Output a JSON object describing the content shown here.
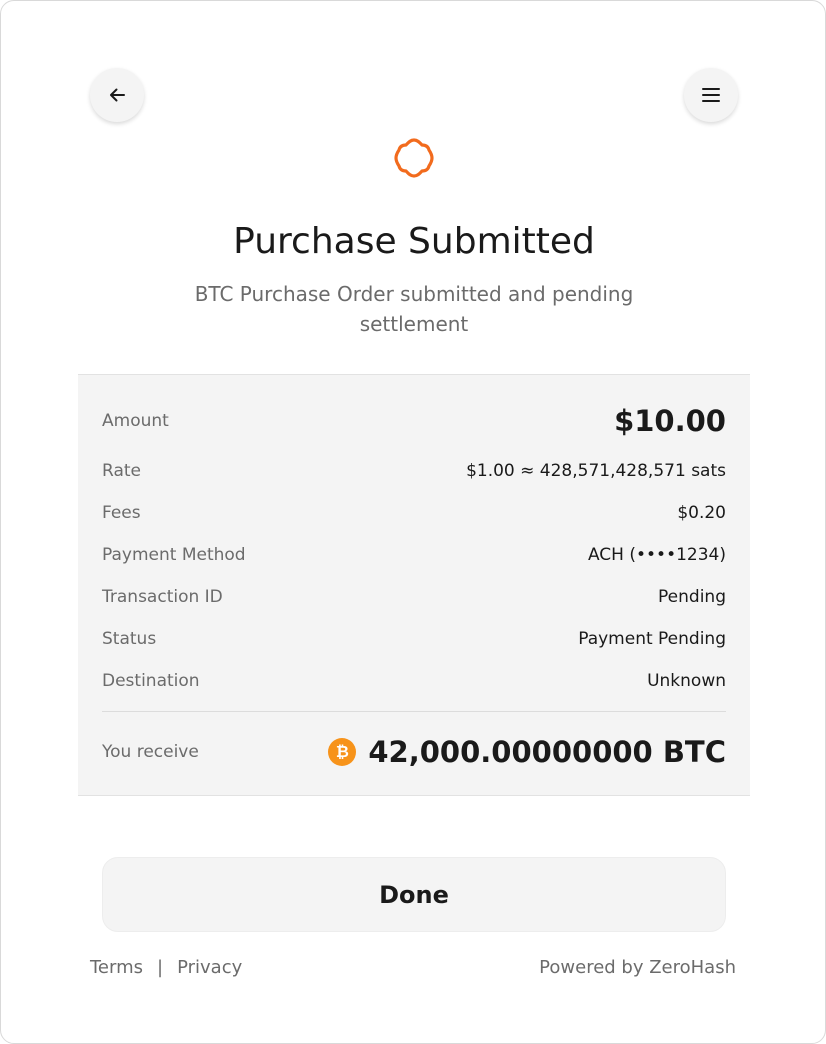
{
  "header": {
    "back_icon": "arrow-left-icon",
    "menu_icon": "hamburger-menu-icon"
  },
  "status_icon": {
    "name": "pending-spinner-icon",
    "color": "#f26b1d"
  },
  "title": "Purchase Submitted",
  "subtitle": "BTC Purchase Order submitted and pending settlement",
  "details": {
    "amount_label": "Amount",
    "amount_value": "$10.00",
    "rate_label": "Rate",
    "rate_value": "$1.00 ≈ 428,571,428,571 sats",
    "fees_label": "Fees",
    "fees_value": "$0.20",
    "payment_method_label": "Payment Method",
    "payment_method_value": "ACH (••••1234)",
    "transaction_id_label": "Transaction ID",
    "transaction_id_value": "Pending",
    "status_label": "Status",
    "status_value": "Payment Pending",
    "destination_label": "Destination",
    "destination_value": "Unknown",
    "receive_label": "You receive",
    "receive_value": "42,000.00000000 BTC",
    "receive_icon": "bitcoin-icon",
    "receive_icon_color": "#f7931a"
  },
  "done_label": "Done",
  "footer": {
    "terms": "Terms",
    "separator": "|",
    "privacy": "Privacy",
    "powered_by": "Powered by ZeroHash"
  }
}
